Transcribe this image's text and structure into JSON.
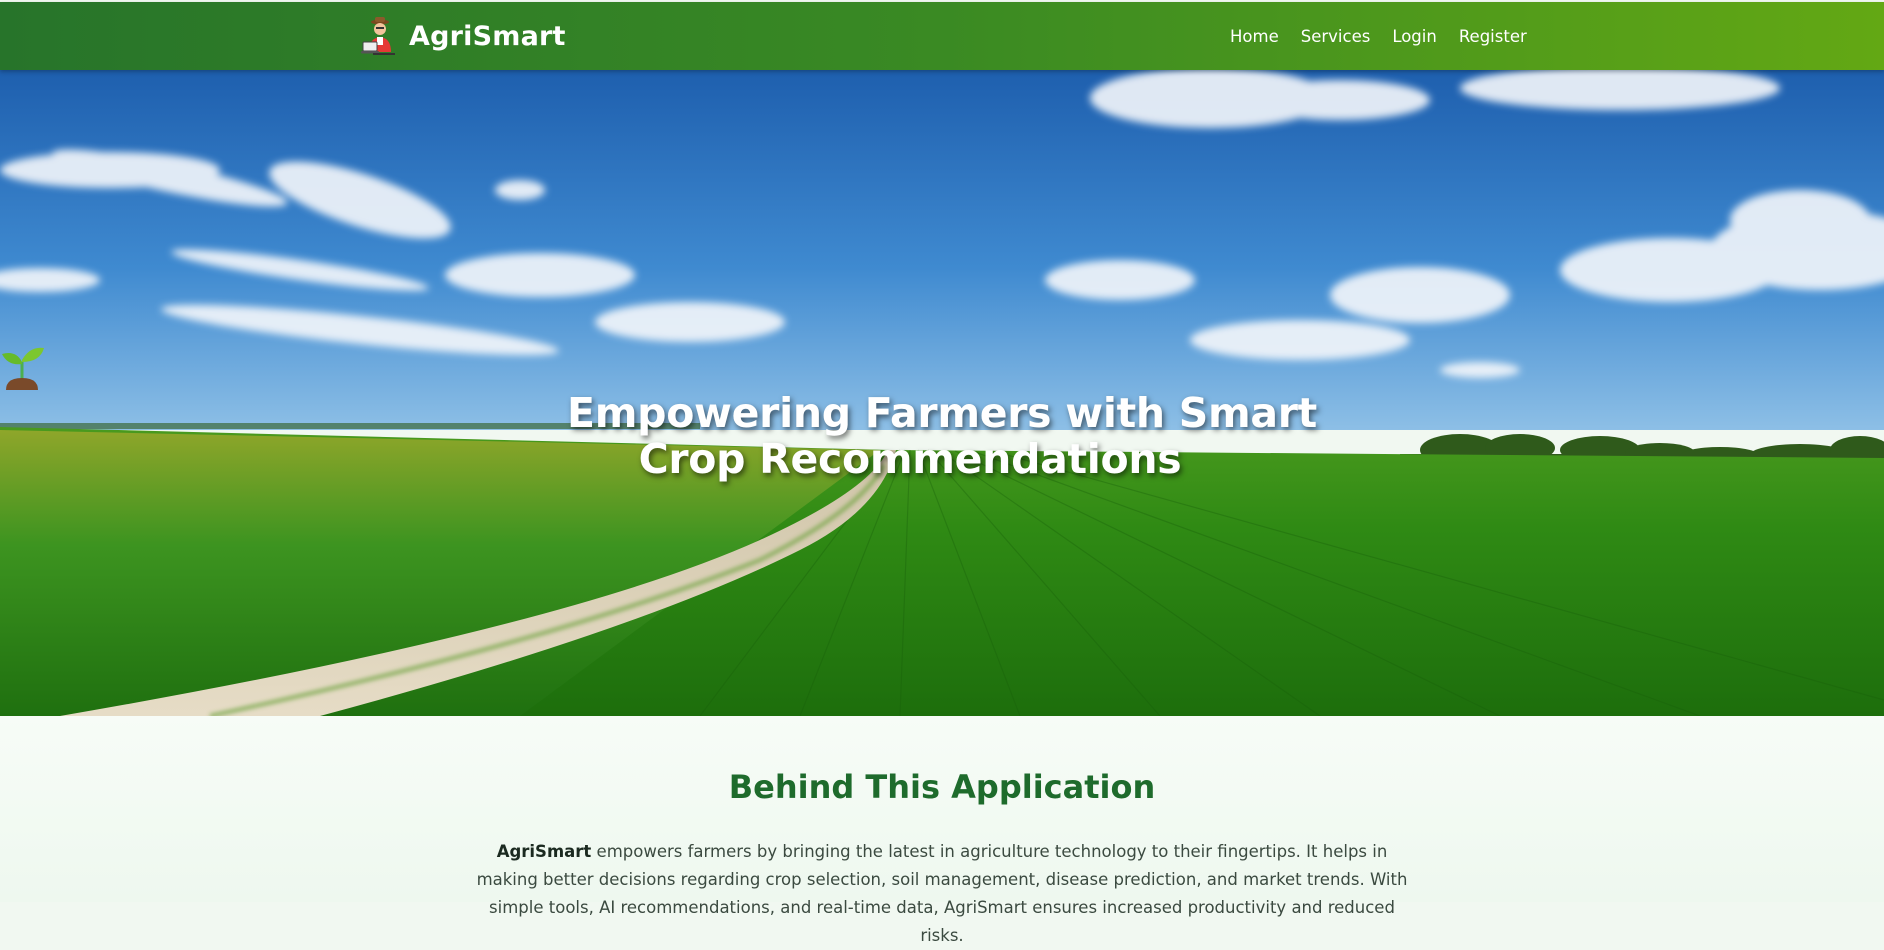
{
  "navbar": {
    "brand": "AgriSmart",
    "brand_logo_icon": "farmer-laptop-icon",
    "links": [
      "Home",
      "Services",
      "Login",
      "Register"
    ],
    "gradient_colors": [
      "#27742a",
      "#63a814"
    ]
  },
  "hero": {
    "title_icon": "sprout-icon",
    "title_line1": "Empowering Farmers with Smart",
    "title_line2": "Crop Recommendations",
    "background": "green-field-blue-sky-dirt-road"
  },
  "about": {
    "heading": "Behind This Application",
    "brand_bold": "AgriSmart",
    "text": " empowers farmers by bringing the latest in agriculture technology to their fingertips. It helps in making better decisions regarding crop selection, soil management, disease prediction, and market trends. With simple tools, AI recommendations, and real-time data, AgriSmart ensures increased productivity and reduced risks."
  },
  "colors": {
    "heading_green": "#1e6b2c",
    "body_text": "#3b4a40",
    "section_bg": "#f1f8f1"
  }
}
